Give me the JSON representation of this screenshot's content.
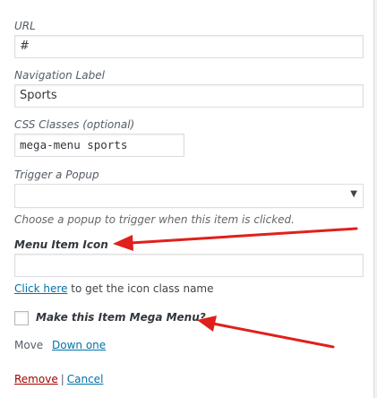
{
  "url": {
    "label": "URL",
    "value": "#"
  },
  "navigation_label": {
    "label": "Navigation Label",
    "value": "Sports"
  },
  "css_classes": {
    "label": "CSS Classes (optional)",
    "value": "mega-menu sports"
  },
  "trigger_popup": {
    "label": "Trigger a Popup",
    "selected": "",
    "description": "Choose a popup to trigger when this item is clicked."
  },
  "menu_item_icon": {
    "label": "Menu Item Icon",
    "value": "",
    "help_link": "Click here",
    "help_text": "to get the icon class name"
  },
  "mega_menu": {
    "label": "Make this Item Mega Menu?",
    "checked": false
  },
  "move": {
    "label": "Move",
    "down_one": "Down one"
  },
  "actions": {
    "remove": "Remove",
    "separator": "|",
    "cancel": "Cancel"
  },
  "annotation": {
    "arrow_color": "#e0201b"
  }
}
